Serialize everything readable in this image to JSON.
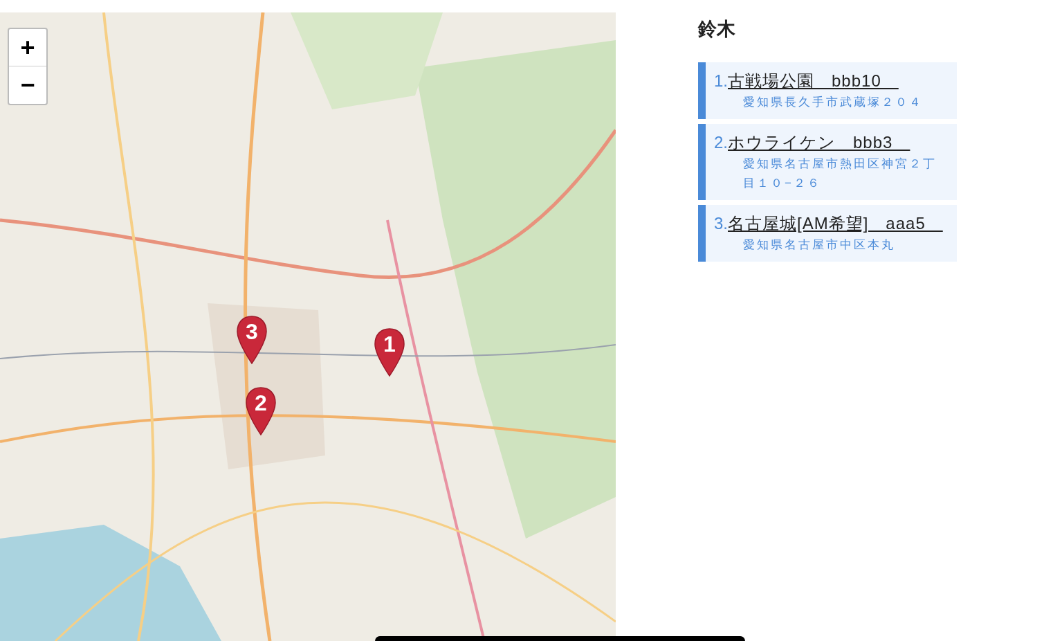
{
  "map": {
    "kind": "picture",
    "zoom_in": "+",
    "zoom_out": "−",
    "markers": [
      {
        "label": "1"
      },
      {
        "label": "2"
      },
      {
        "label": "3"
      }
    ]
  },
  "person": {
    "name": "鈴木"
  },
  "places": [
    {
      "number": "1.",
      "title": "古戦場公園　bbb10　",
      "address": "愛知県長久手市武蔵塚２０４"
    },
    {
      "number": "2.",
      "title": "ホウライケン　bbb3　",
      "address": "愛知県名古屋市熱田区神宮２丁目１０−２６"
    },
    {
      "number": "3.",
      "title": "名古屋城[AM希望]　aaa5　",
      "address": "愛知県名古屋市中区本丸"
    }
  ]
}
